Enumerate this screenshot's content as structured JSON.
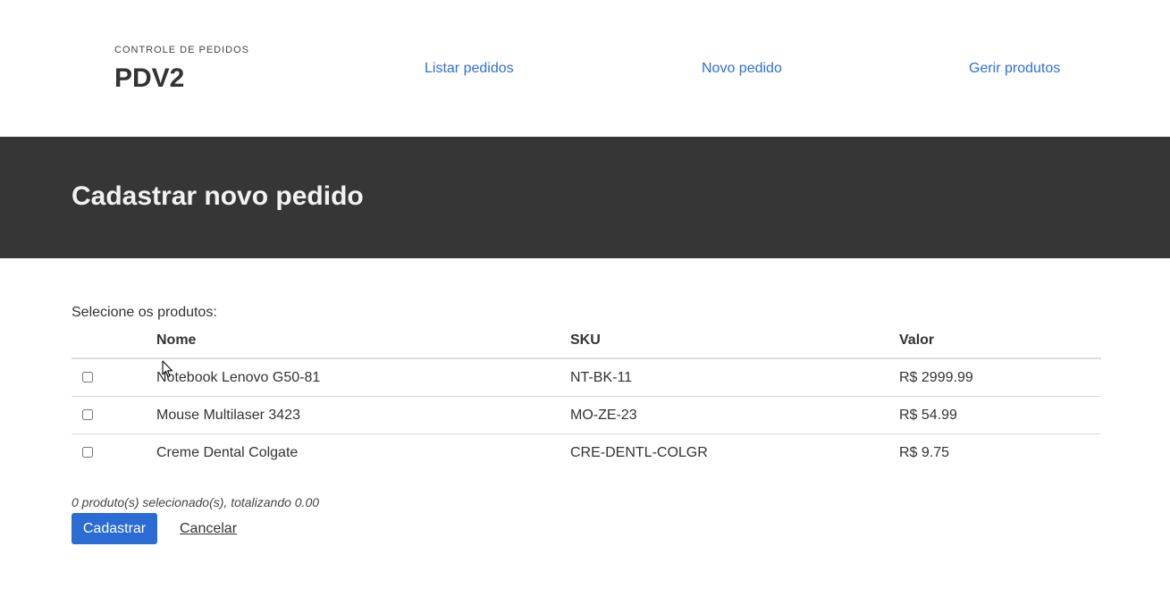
{
  "header": {
    "subtitle": "CONTROLE DE PEDIDOS",
    "title": "PDV2",
    "nav": [
      {
        "label": "Listar pedidos"
      },
      {
        "label": "Novo pedido"
      },
      {
        "label": "Gerir produtos"
      }
    ]
  },
  "banner": {
    "title": "Cadastrar novo pedido"
  },
  "form": {
    "prompt": "Selecione os produtos:",
    "columns": [
      "",
      "Nome",
      "SKU",
      "Valor"
    ],
    "rows": [
      {
        "checked": false,
        "name": "Notebook Lenovo G50-81",
        "sku": "NT-BK-11",
        "value": "R$ 2999.99"
      },
      {
        "checked": false,
        "name": "Mouse Multilaser 3423",
        "sku": "MO-ZE-23",
        "value": "R$ 54.99"
      },
      {
        "checked": false,
        "name": "Creme Dental Colgate",
        "sku": "CRE-DENTL-COLGR",
        "value": "R$ 9.75"
      }
    ],
    "summary": "0 produto(s) selecionado(s), totalizando 0.00",
    "submit_label": "Cadastrar",
    "cancel_label": "Cancelar"
  },
  "colors": {
    "link": "#2f6fd6",
    "banner_bg": "#363636",
    "primary_button": "#2b6cd4"
  },
  "icons": [
    "mouse-cursor-icon"
  ]
}
